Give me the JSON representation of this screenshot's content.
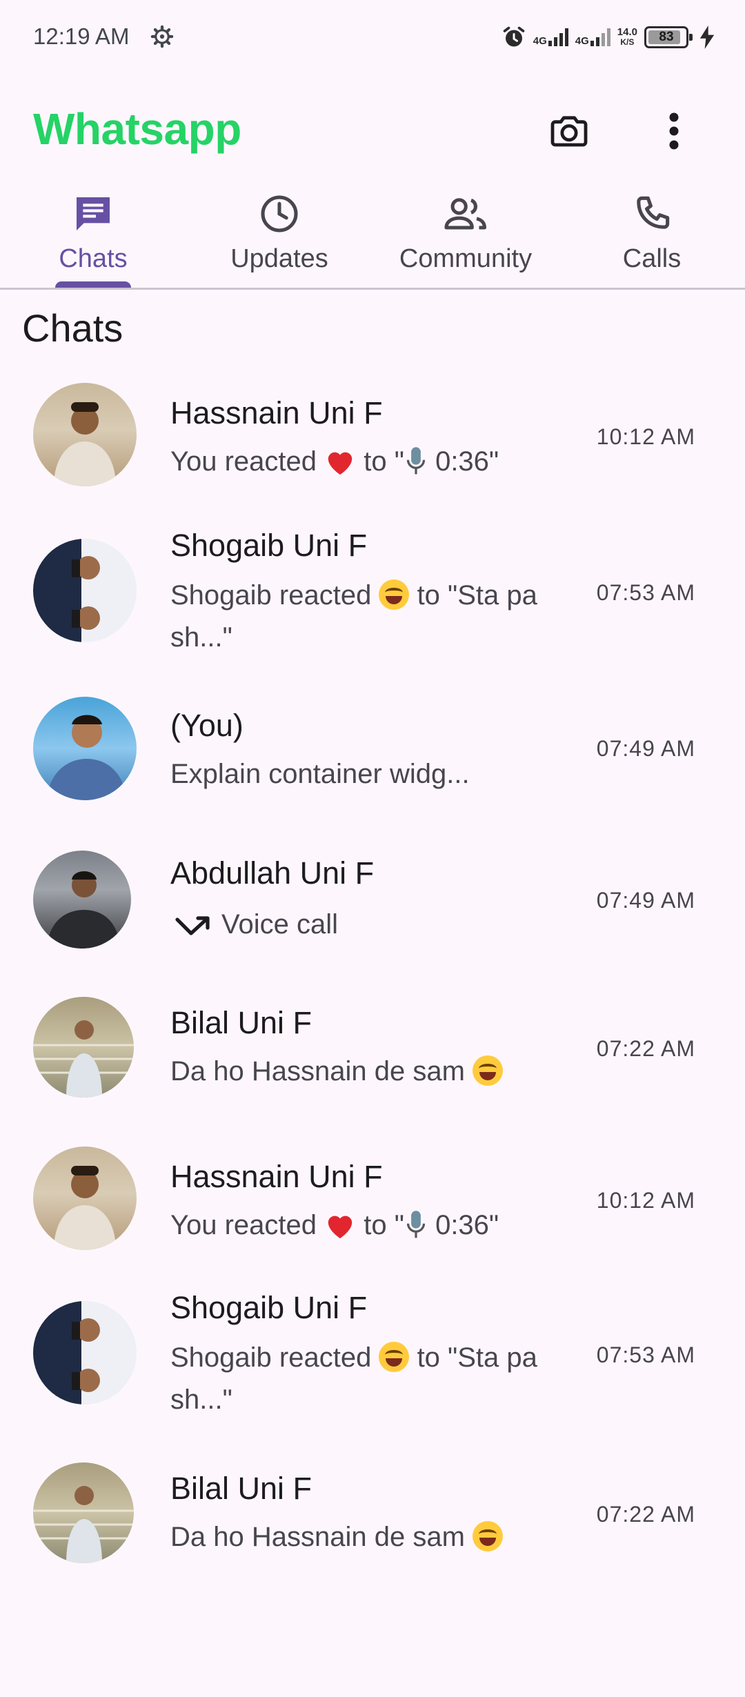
{
  "status_bar": {
    "time": "12:19 AM",
    "net1": "4G",
    "net2": "4G",
    "speed_value": "14.0",
    "speed_unit": "K/S",
    "battery": "83"
  },
  "app_bar": {
    "title": "Whatsapp",
    "title_color": "#25d366"
  },
  "tabs": [
    {
      "label": "Chats",
      "icon": "chat-icon",
      "active": true
    },
    {
      "label": "Updates",
      "icon": "clock-icon",
      "active": false
    },
    {
      "label": "Community",
      "icon": "people-icon",
      "active": false
    },
    {
      "label": "Calls",
      "icon": "phone-icon",
      "active": false
    }
  ],
  "accent_color": "#6750a4",
  "section_title": "Chats",
  "chats": [
    {
      "name": "Hassnain Uni F",
      "msg_pre": "You reacted ",
      "msg_emoji": "heart",
      "msg_mid": " to \"",
      "msg_emoji2": "microphone",
      "msg_post": " 0:36\"",
      "time": "10:12 AM"
    },
    {
      "name": "Shogaib Uni F",
      "msg_pre": "Shogaib reacted ",
      "msg_emoji": "laughing",
      "msg_post": " to \"Sta pa sh...\"",
      "time": "07:53 AM"
    },
    {
      "name": "(You)",
      "msg": "Explain container widg...",
      "time": "07:49 AM"
    },
    {
      "name": "Abdullah Uni F",
      "msg": "Voice call",
      "msg_icon": "outgoing-call-icon",
      "time": "07:49 AM"
    },
    {
      "name": "Bilal Uni F",
      "msg_pre": "Da ho Hassnain de sam ",
      "msg_emoji": "laughing",
      "time": "07:22 AM"
    },
    {
      "name": "Hassnain Uni F",
      "msg_pre": "You reacted ",
      "msg_emoji": "heart",
      "msg_mid": " to \"",
      "msg_emoji2": "microphone",
      "msg_post": " 0:36\"",
      "time": "10:12 AM"
    },
    {
      "name": "Shogaib Uni F",
      "msg_pre": "Shogaib reacted ",
      "msg_emoji": "laughing",
      "msg_post": " to \"Sta pa sh...\"",
      "time": "07:53 AM"
    },
    {
      "name": "Bilal Uni F",
      "msg_pre": "Da ho Hassnain de sam ",
      "msg_emoji": "laughing",
      "time": "07:22 AM"
    }
  ]
}
